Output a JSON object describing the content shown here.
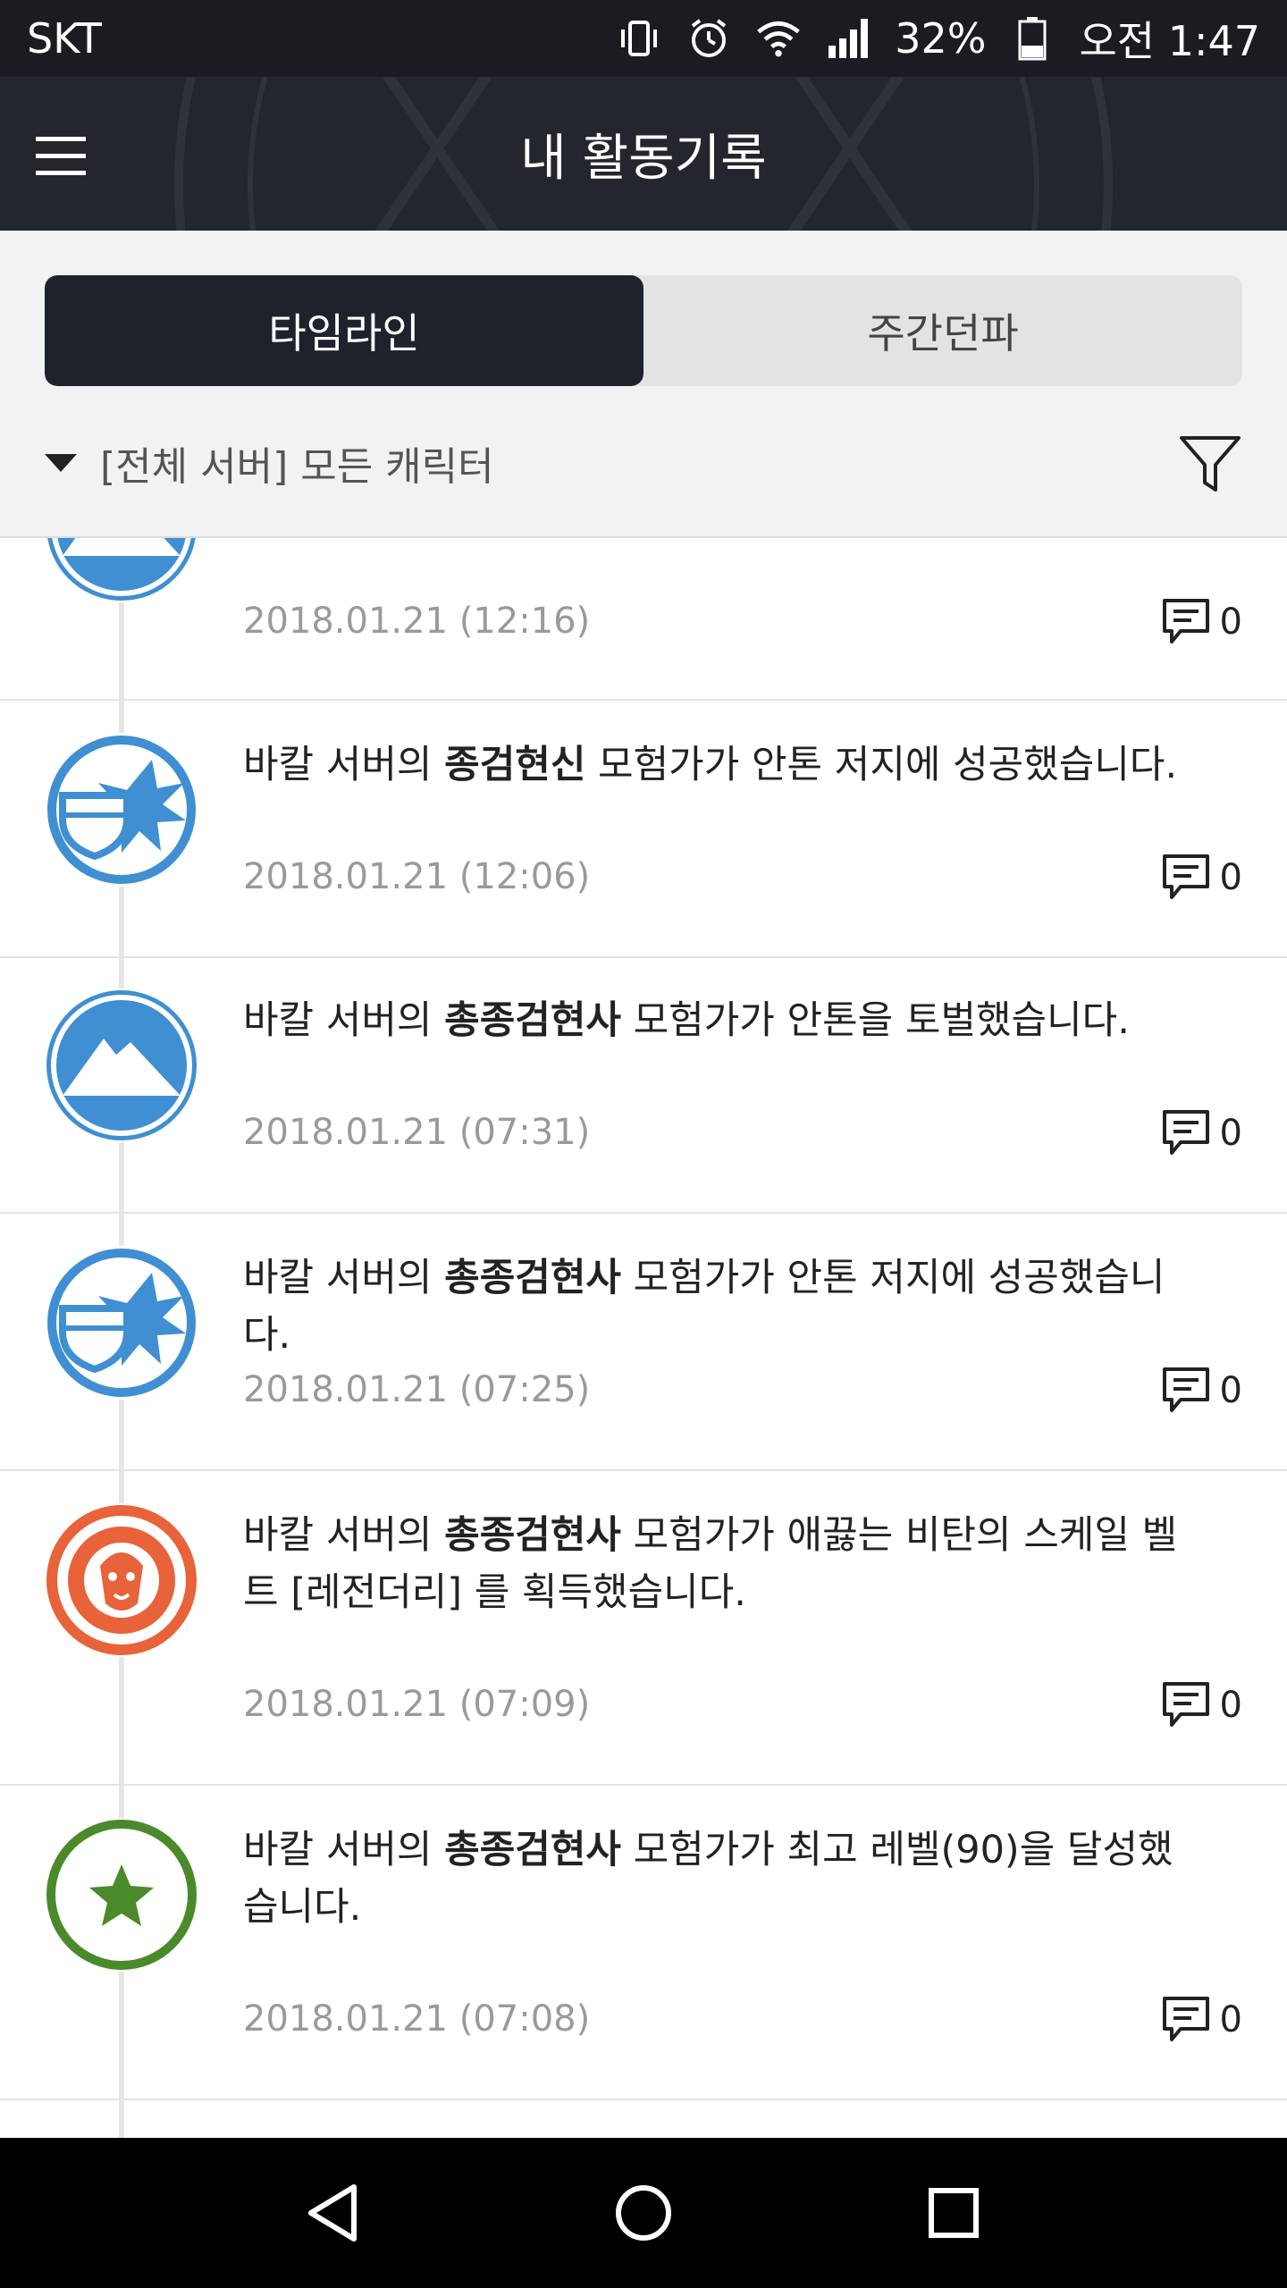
{
  "status_bar": {
    "carrier": "SKT",
    "battery": "32%",
    "time": "오전 1:47",
    "icons": [
      "vibrate-icon",
      "alarm-icon",
      "wifi-icon",
      "signal-icon",
      "battery-icon"
    ]
  },
  "header": {
    "title": "내 활동기록",
    "menu_icon": "hamburger-menu-icon"
  },
  "tabs": [
    {
      "label": "타임라인",
      "active": true
    },
    {
      "label": "주간던파",
      "active": false
    }
  ],
  "filter": {
    "scope": "[전체 서버] 모든 캐릭터",
    "icon": "filter-funnel-icon"
  },
  "colors": {
    "blue": "#3f8fd2",
    "orange": "#e8623a",
    "green": "#4a8a2a",
    "dark": "#1e222b"
  },
  "items": [
    {
      "icon": "mountain-icon",
      "pre": "",
      "name": "",
      "post": "",
      "date": "2018.01.21 (12:16)",
      "comments": "0"
    },
    {
      "icon": "shield-burst-icon",
      "pre": "바칼 서버의 ",
      "name": "종검현신",
      "post": " 모험가가 안톤 저지에 성공했습니다.",
      "date": "2018.01.21 (12:06)",
      "comments": "0"
    },
    {
      "icon": "mountain-icon",
      "pre": "바칼 서버의 ",
      "name": "총종검현사",
      "post": " 모험가가 안톤을 토벌했습니다.",
      "date": "2018.01.21 (07:31)",
      "comments": "0"
    },
    {
      "icon": "shield-burst-icon",
      "pre": "바칼 서버의 ",
      "name": "총종검현사",
      "post": " 모험가가 안톤 저지에 성공했습니다.",
      "date": "2018.01.21 (07:25)",
      "comments": "0"
    },
    {
      "icon": "lion-gear-icon",
      "pre": "바칼 서버의 ",
      "name": "총종검현사",
      "post": " 모험가가 애끓는 비탄의 스케일 벨트 [레전더리] 를 획득했습니다.",
      "date": "2018.01.21 (07:09)",
      "comments": "0"
    },
    {
      "icon": "star-icon",
      "pre": "바칼 서버의 ",
      "name": "총종검현사",
      "post": " 모험가가 최고 레벨(90)을 달성했습니다.",
      "date": "2018.01.21 (07:08)",
      "comments": "0"
    }
  ],
  "nav": {
    "back": "back-triangle-icon",
    "home": "home-circle-icon",
    "recents": "recents-square-icon"
  }
}
